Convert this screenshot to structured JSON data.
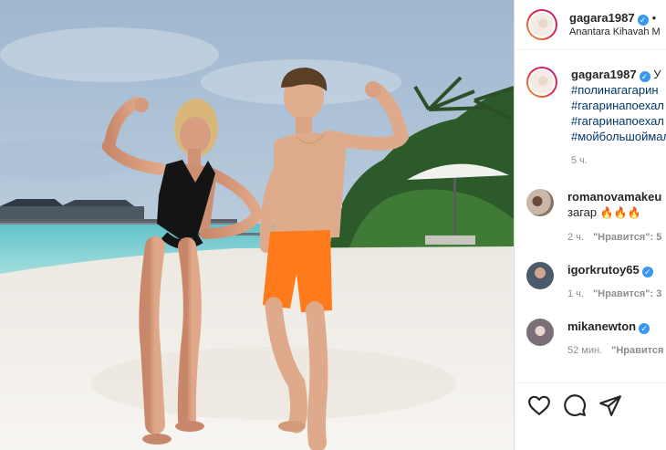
{
  "post": {
    "author": "gagara1987",
    "header_separator": "•",
    "location": "Anantara Kihavah M",
    "caption": {
      "prefix": "У",
      "hashtags": [
        "#полинагагарин",
        "#гагаринапоехал",
        "#гагаринапоехал",
        "#мойбольшоймал"
      ],
      "time": "5 ч."
    }
  },
  "comments": [
    {
      "user": "romanovamakeu",
      "verified": false,
      "text": "загар",
      "emoji": "🔥🔥🔥",
      "time": "2 ч.",
      "like_label": "\"Нравится\": 5"
    },
    {
      "user": "igorkrutoy65",
      "verified": true,
      "text": "",
      "emoji": "",
      "time": "1 ч.",
      "like_label": "\"Нравится\": 3"
    },
    {
      "user": "mikanewton",
      "verified": true,
      "text": "",
      "emoji": "",
      "time": "52 мин.",
      "like_label": "\"Нравится"
    }
  ],
  "icons": {
    "verified": "verified-badge",
    "like": "heart-icon",
    "comment": "comment-bubble-icon",
    "share": "paper-plane-icon"
  },
  "colors": {
    "hashtag": "#00376b",
    "verified": "#3897f0",
    "meta": "#8e8e8e"
  }
}
